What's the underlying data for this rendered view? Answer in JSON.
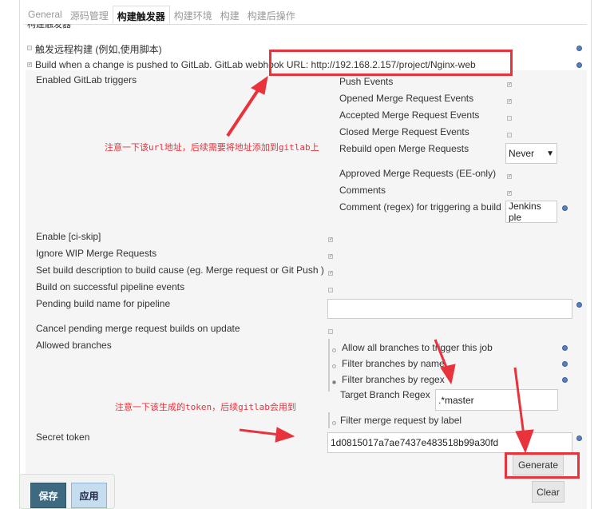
{
  "tabs": [
    {
      "label": "General"
    },
    {
      "label": "源码管理"
    },
    {
      "label": "构建触发器"
    },
    {
      "label": "构建环境"
    },
    {
      "label": "构建"
    },
    {
      "label": "构建后操作"
    }
  ],
  "section_title": "构建触发器",
  "remote_trigger": {
    "label": "触发远程构建 (例如,使用脚本)",
    "checked": false
  },
  "gitlab_trigger": {
    "label": "Build when a change is pushed to GitLab. GitLab webhook URL: http://192.168.2.157/project/Nginx-web",
    "checked": true
  },
  "enabled_triggers_label": "Enabled GitLab triggers",
  "triggers": [
    {
      "label": "Push Events",
      "checked": true
    },
    {
      "label": "Opened Merge Request Events",
      "checked": true
    },
    {
      "label": "Accepted Merge Request Events",
      "checked": false
    },
    {
      "label": "Closed Merge Request Events",
      "checked": false
    },
    {
      "label": "Rebuild open Merge Requests",
      "select": "Never"
    },
    {
      "label": "Approved Merge Requests (EE-only)",
      "checked": true
    },
    {
      "label": "Comments",
      "checked": true
    },
    {
      "label": "Comment (regex) for triggering a build",
      "value": "Jenkins ple"
    }
  ],
  "options": [
    {
      "label": "Enable [ci-skip]",
      "checked": true
    },
    {
      "label": "Ignore WIP Merge Requests",
      "checked": true
    },
    {
      "label": "Set build description to build cause (eg. Merge request or Git Push )",
      "checked": true
    },
    {
      "label": "Build on successful pipeline events",
      "checked": false
    }
  ],
  "pending_build_name": {
    "label": "Pending build name for pipeline",
    "value": ""
  },
  "cancel_pending": {
    "label": "Cancel pending merge request builds on update",
    "checked": false
  },
  "allowed_branches": {
    "label": "Allowed branches",
    "choices": [
      {
        "label": "Allow all branches to trigger this job",
        "selected": false
      },
      {
        "label": "Filter branches by name",
        "selected": false
      },
      {
        "label": "Filter branches by regex",
        "selected": true
      }
    ],
    "target_regex_label": "Target Branch Regex",
    "target_regex_value": ".*master",
    "filter_label": "Filter merge request by label"
  },
  "secret_token": {
    "label": "Secret token",
    "value": "1d0815017a7ae7437e483518b99a30fd"
  },
  "buttons": {
    "generate": "Generate",
    "clear": "Clear",
    "save": "保存",
    "apply": "应用"
  },
  "annotations": {
    "url_note": "注意一下该url地址，后续需要将地址添加到gitlab上",
    "token_note": "注意一下该生成的token，后续gitlab会用到"
  },
  "colors": {
    "annotation": "#e8323c",
    "save_button": "#3d6a80",
    "apply_button": "#c6dcef"
  }
}
